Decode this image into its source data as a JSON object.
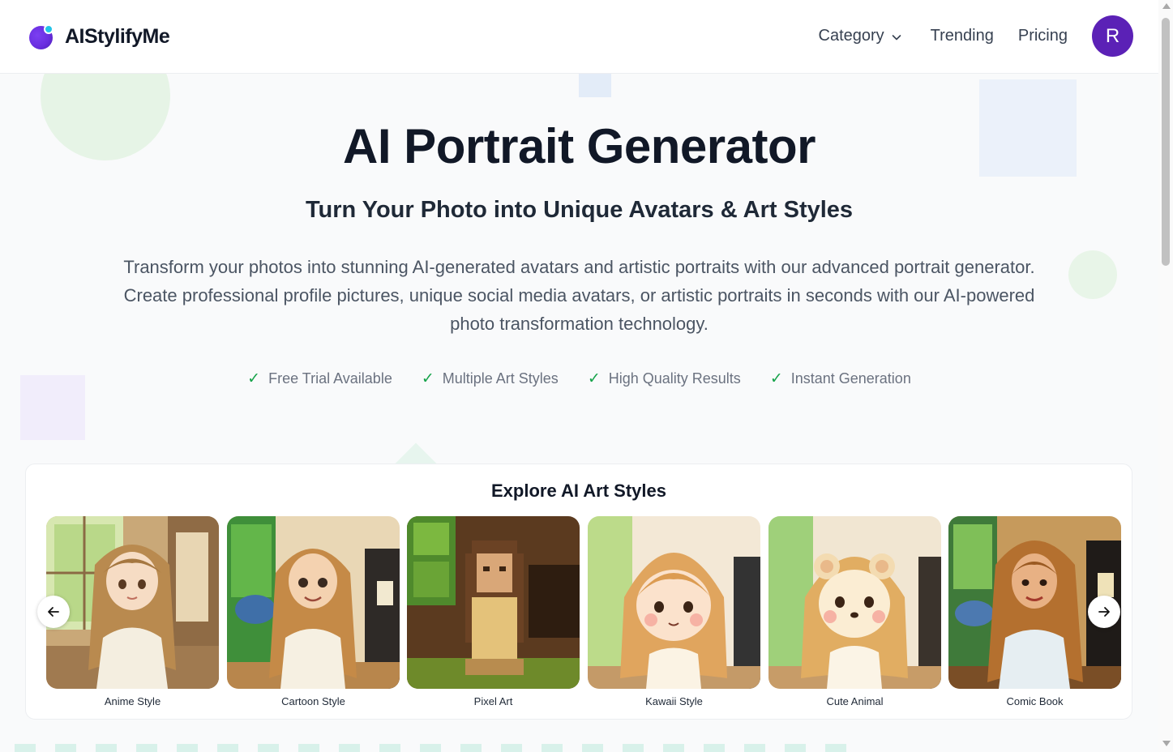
{
  "header": {
    "brand": "AIStylifyMe",
    "nav": {
      "category": "Category",
      "trending": "Trending",
      "pricing": "Pricing"
    },
    "avatar_initial": "R"
  },
  "hero": {
    "title": "AI Portrait Generator",
    "subtitle": "Turn Your Photo into Unique Avatars & Art Styles",
    "description": "Transform your photos into stunning AI-generated avatars and artistic portraits with our advanced portrait generator. Create professional profile pictures, unique social media avatars, or artistic portraits in seconds with our AI-powered photo transformation technology.",
    "features": [
      "Free Trial Available",
      "Multiple Art Styles",
      "High Quality Results",
      "Instant Generation"
    ]
  },
  "styles_section": {
    "title": "Explore AI Art Styles",
    "items": [
      {
        "label": "Anime Style"
      },
      {
        "label": "Cartoon Style"
      },
      {
        "label": "Pixel Art"
      },
      {
        "label": "Kawaii Style"
      },
      {
        "label": "Cute Animal"
      },
      {
        "label": "Comic Book"
      }
    ]
  },
  "colors": {
    "brand_purple": "#5b21b6",
    "check_green": "#16a34a"
  },
  "icons": {
    "prev": "arrow-left-icon",
    "next": "arrow-right-icon",
    "dropdown": "chevron-down-icon",
    "feature": "check-icon"
  }
}
